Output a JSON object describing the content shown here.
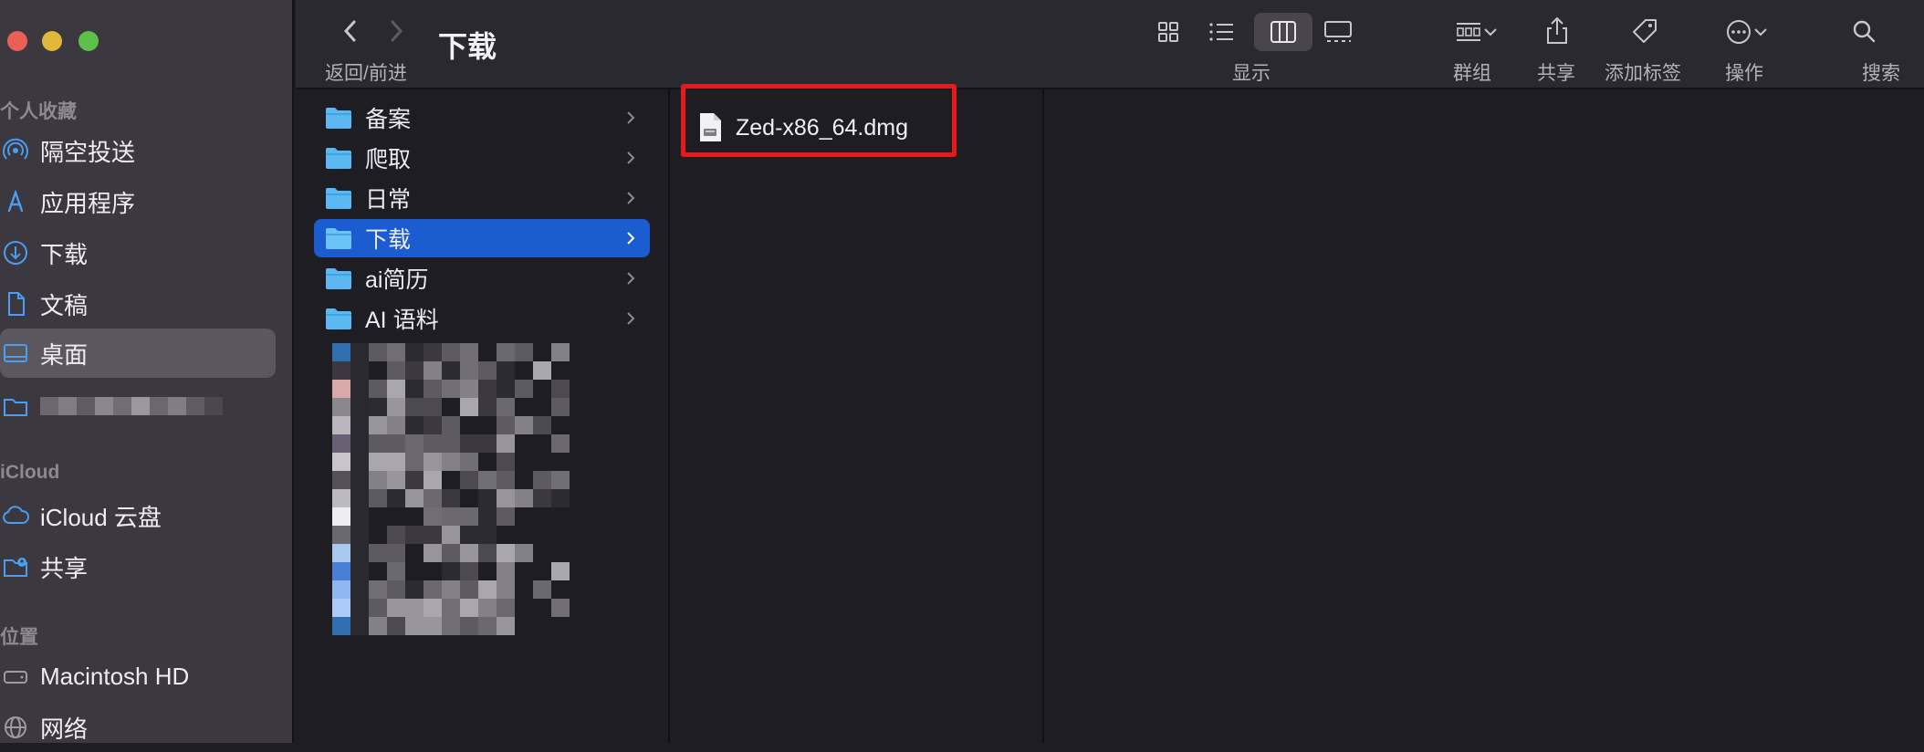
{
  "window": {
    "title": "下载"
  },
  "toolbar": {
    "back_forward_label": "返回/前进",
    "view_label": "显示",
    "group_label": "群组",
    "share_label": "共享",
    "tag_label": "添加标签",
    "action_label": "操作",
    "search_label": "搜索"
  },
  "sidebar": {
    "favorites_heading": "个人收藏",
    "favorites": [
      {
        "label": "隔空投送",
        "icon": "airdrop-icon"
      },
      {
        "label": "应用程序",
        "icon": "applications-icon"
      },
      {
        "label": "下载",
        "icon": "download-icon"
      },
      {
        "label": "文稿",
        "icon": "document-icon"
      },
      {
        "label": "桌面",
        "icon": "desktop-icon",
        "selected": true
      },
      {
        "label": "",
        "icon": "folder-icon",
        "blurred": true
      }
    ],
    "icloud_heading": "iCloud",
    "icloud": [
      {
        "label": "iCloud 云盘",
        "icon": "cloud-icon"
      },
      {
        "label": "共享",
        "icon": "shared-folder-icon"
      }
    ],
    "locations_heading": "位置",
    "locations": [
      {
        "label": "Macintosh HD",
        "icon": "disk-icon"
      },
      {
        "label": "网络",
        "icon": "network-icon"
      }
    ]
  },
  "column1": {
    "items": [
      {
        "label": "备案",
        "icon": "folder-icon"
      },
      {
        "label": "爬取",
        "icon": "folder-icon"
      },
      {
        "label": "日常",
        "icon": "folder-icon"
      },
      {
        "label": "下载",
        "icon": "folder-icon",
        "selected": true
      },
      {
        "label": "ai简历",
        "icon": "folder-icon"
      },
      {
        "label": "AI 语料",
        "icon": "folder-icon"
      }
    ]
  },
  "column2": {
    "items": [
      {
        "label": "Zed-x86_64.dmg",
        "icon": "dmg-file-icon",
        "highlighted": true
      }
    ]
  },
  "colors": {
    "selection_blue": "#1b5cd1",
    "folder_blue": "#5cb8f2",
    "highlight_red": "#e8191b",
    "accent_icon": "#4a9df0"
  }
}
